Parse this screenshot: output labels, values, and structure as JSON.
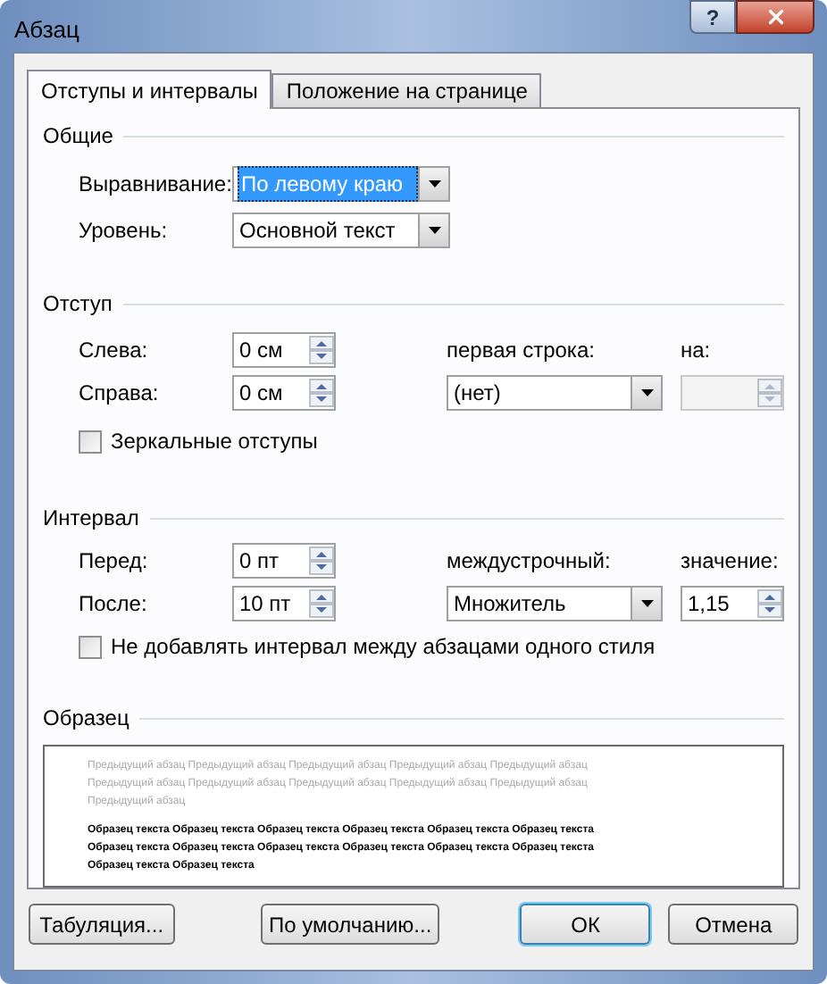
{
  "window": {
    "title": "Абзац",
    "help": "?"
  },
  "tabs": [
    {
      "label": "Отступы и интервалы",
      "selected": true
    },
    {
      "label": "Положение на странице",
      "selected": false
    }
  ],
  "general": {
    "title": "Общие",
    "alignment": {
      "label": "Выравнивание:",
      "value": "По левому краю",
      "selected": true
    },
    "level": {
      "label": "Уровень:",
      "value": "Основной текст",
      "selected": false
    }
  },
  "indent": {
    "title": "Отступ",
    "left": {
      "label": "Слева:",
      "value": "0 см"
    },
    "right": {
      "label": "Справа:",
      "value": "0 см"
    },
    "first_line": {
      "label": "первая строка:",
      "value": "(нет)"
    },
    "by": {
      "label": "на:",
      "disabled": true
    },
    "mirror": {
      "label": "Зеркальные отступы",
      "checked": false
    }
  },
  "spacing": {
    "title": "Интервал",
    "before": {
      "label": "Перед:",
      "value": "0 пт"
    },
    "after": {
      "label": "После:",
      "value": "10 пт"
    },
    "line_spacing": {
      "label": "междустрочный:",
      "value": "Множитель"
    },
    "at": {
      "label": "значение:",
      "value": "1,15",
      "disabled": false
    },
    "no_space": {
      "label": "Не добавлять интервал между абзацами одного стиля",
      "checked": false
    }
  },
  "preview": {
    "title": "Образец",
    "previous_lines": [
      "Предыдущий абзац Предыдущий абзац Предыдущий абзац Предыдущий абзац Предыдущий абзац",
      "Предыдущий абзац Предыдущий абзац Предыдущий абзац Предыдущий абзац Предыдущий абзац",
      "Предыдущий абзац"
    ],
    "sample_lines": [
      "Образец текста Образец текста Образец текста Образец текста Образец текста Образец текста",
      "Образец текста Образец текста Образец текста Образец текста Образец текста Образец текста",
      "Образец текста Образец текста"
    ]
  },
  "buttons": [
    {
      "label": "Табуляция...",
      "default": false
    },
    {
      "label": "По умолчанию...",
      "default": false
    },
    {
      "label": "ОК",
      "default": true
    },
    {
      "label": "Отмена",
      "default": false
    }
  ]
}
